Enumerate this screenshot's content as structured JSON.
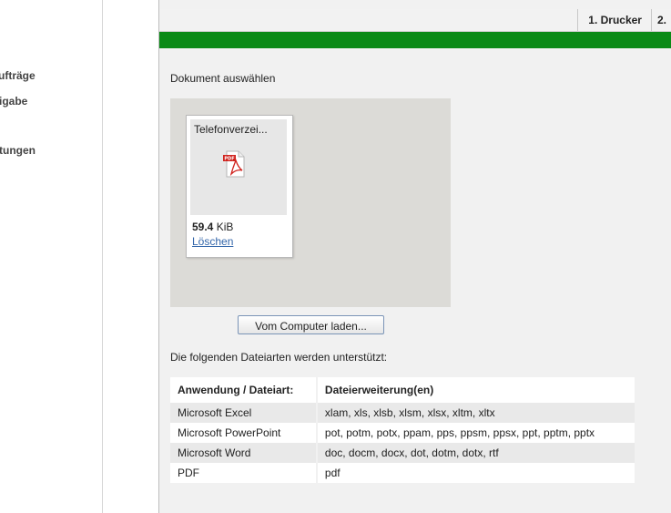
{
  "sidebar": {
    "items": [
      {
        "label": "ufträge"
      },
      {
        "label": "igabe"
      },
      {
        "label": "tungen"
      }
    ]
  },
  "header": {
    "steps": [
      {
        "label": "1. Drucker"
      },
      {
        "label": "2."
      }
    ]
  },
  "document": {
    "section_title": "Dokument auswählen",
    "file": {
      "name": "Telefonverzei...",
      "size_value": "59.4",
      "size_unit": "KiB",
      "delete_label": "Löschen",
      "icon": "pdf-file-icon"
    },
    "upload_label": "Vom Computer laden...",
    "supported_text": "Die folgenden Dateiarten werden unterstützt:"
  },
  "filetypes": {
    "headers": [
      "Anwendung / Dateiart:",
      "Dateierweiterung(en)"
    ],
    "rows": [
      {
        "app": "Microsoft Excel",
        "ext": "xlam, xls, xlsb, xlsm, xlsx, xltm, xltx"
      },
      {
        "app": "Microsoft PowerPoint",
        "ext": "pot, potm, potx, ppam, pps, ppsm, ppsx, ppt, pptm, pptx"
      },
      {
        "app": "Microsoft Word",
        "ext": "doc, docm, docx, dot, dotm, dotx, rtf"
      },
      {
        "app": "PDF",
        "ext": "pdf"
      }
    ]
  },
  "colors": {
    "accent_green": "#0a8a16",
    "link_blue": "#3366aa"
  }
}
